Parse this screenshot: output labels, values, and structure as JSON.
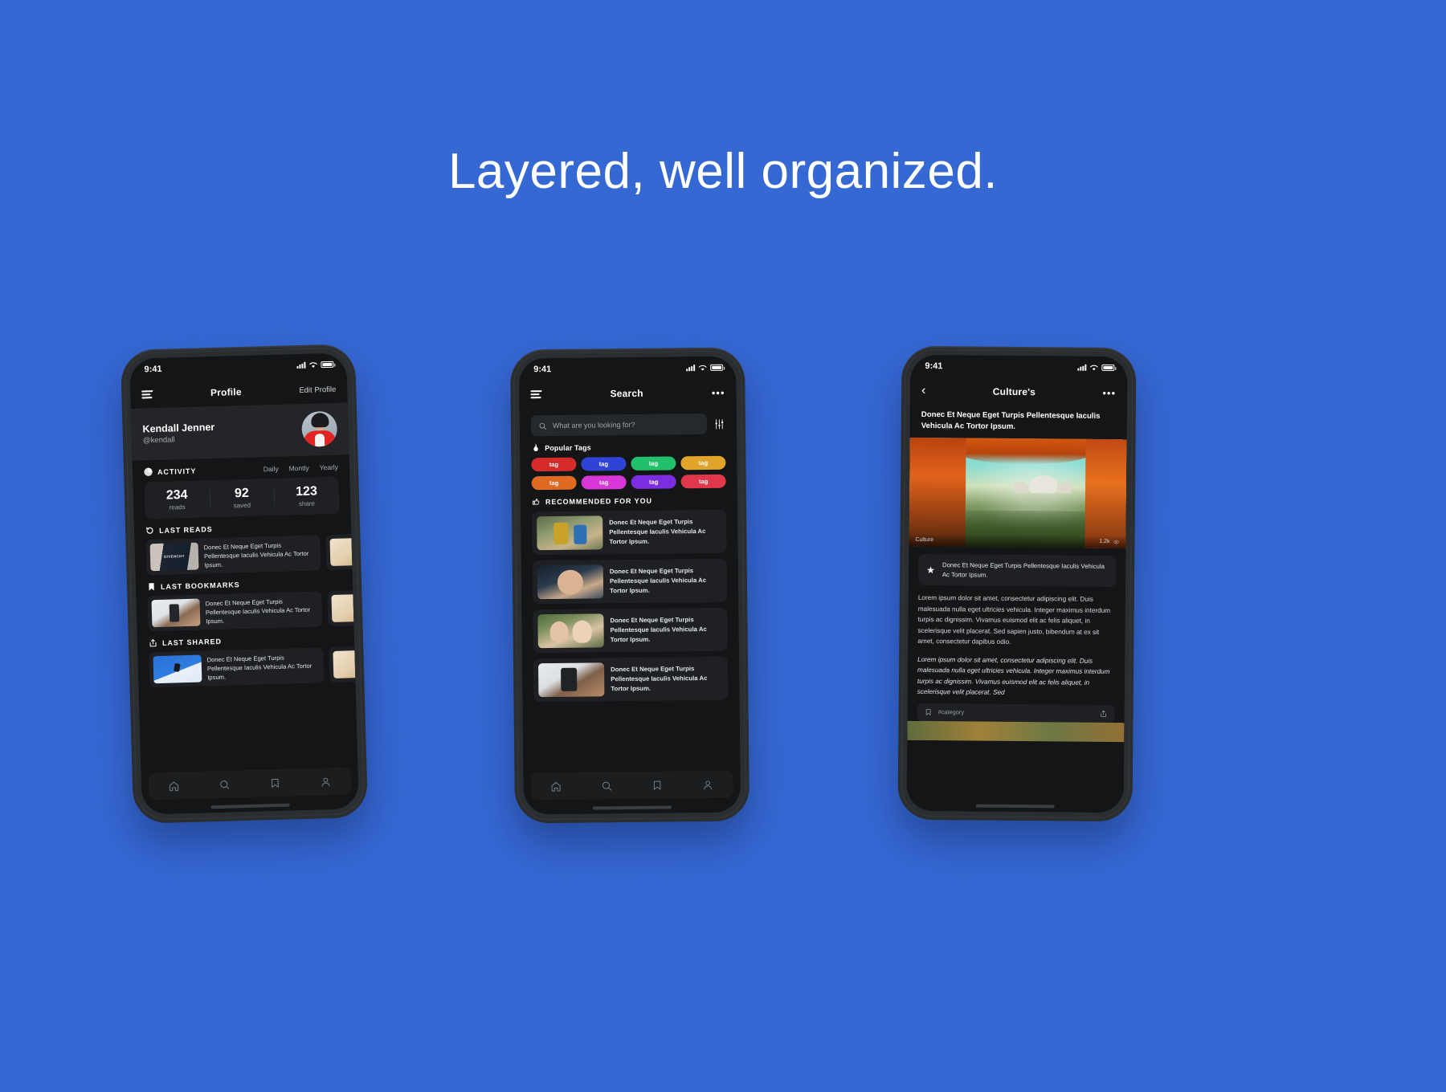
{
  "headline": "Layered, well organized.",
  "theme": {
    "background": "#3668d4",
    "surface": "#141516",
    "card": "#1e2023",
    "accent": "#2f6fdc"
  },
  "phone1": {
    "status": {
      "time": "9:41"
    },
    "navbar": {
      "menu_icon": "hamburger-icon",
      "title": "Profile",
      "action": "Edit Profile"
    },
    "profile": {
      "name": "Kendall Jenner",
      "handle": "@kendall",
      "avatar": "user-avatar"
    },
    "activity": {
      "icon": "pie-chart-icon",
      "label": "ACTIVITY",
      "segments": [
        "Daily",
        "Montly",
        "Yearly"
      ],
      "stats": [
        {
          "value": "234",
          "label": "reads"
        },
        {
          "value": "92",
          "label": "saved"
        },
        {
          "value": "123",
          "label": "share"
        }
      ]
    },
    "sections": [
      {
        "icon": "history-icon",
        "label": "LAST READS",
        "item": "Donec Et Neque Eget Turpis Pellentesque Iaculis Vehicula Ac Tortor Ipsum."
      },
      {
        "icon": "bookmark-icon",
        "label": "LAST BOOKMARKS",
        "item": "Donec Et Neque Eget Turpis Pellentesque Iaculis Vehicula Ac Tortor Ipsum."
      },
      {
        "icon": "share-icon",
        "label": "LAST SHARED",
        "item": "Donec Et Neque Eget Turpis Pellentesque Iaculis Vehicula Ac Tortor Ipsum."
      }
    ],
    "tabs": [
      "home-icon",
      "search-icon",
      "bookmark-icon",
      "person-icon"
    ]
  },
  "phone2": {
    "status": {
      "time": "9:41"
    },
    "navbar": {
      "menu_icon": "hamburger-icon",
      "title": "Search",
      "action": "more-icon"
    },
    "search": {
      "placeholder": "What are you looking for?",
      "icon": "search-icon",
      "filter_icon": "filter-sliders-icon"
    },
    "popular": {
      "icon": "fire-icon",
      "label": "Popular Tags",
      "tags": [
        {
          "label": "tag",
          "color": "#d62b2b"
        },
        {
          "label": "tag",
          "color": "#2f44d6"
        },
        {
          "label": "tag",
          "color": "#22c06a"
        },
        {
          "label": "tag",
          "color": "#e0a42a"
        },
        {
          "label": "tag",
          "color": "#e06a22"
        },
        {
          "label": "tag",
          "color": "#d637d6"
        },
        {
          "label": "tag",
          "color": "#7b2ee0"
        },
        {
          "label": "tag",
          "color": "#e0384a"
        }
      ]
    },
    "recommended": {
      "icon": "thumbs-up-icon",
      "label": "RECOMMENDED FOR YOU",
      "items": [
        {
          "text": "Donec Et Neque Eget Turpis Pellentesque Iaculis Vehicula Ac Tortor Ipsum.",
          "thumb": "dancers-thumb"
        },
        {
          "text": "Donec Et Neque Eget Turpis Pellentesque Iaculis Vehicula Ac Tortor Ipsum.",
          "thumb": "girl-thumb"
        },
        {
          "text": "Donec Et Neque Eget Turpis Pellentesque Iaculis Vehicula Ac Tortor Ipsum.",
          "thumb": "two-women-thumb"
        },
        {
          "text": "Donec Et Neque Eget Turpis Pellentesque Iaculis Vehicula Ac Tortor Ipsum.",
          "thumb": "hand-phone-thumb"
        }
      ]
    },
    "tabs": [
      "home-icon",
      "search-icon",
      "bookmark-icon",
      "person-icon"
    ]
  },
  "phone3": {
    "status": {
      "time": "9:41"
    },
    "navbar": {
      "back_icon": "chevron-left-icon",
      "title": "Culture's",
      "action": "more-icon"
    },
    "article": {
      "title": "Donec Et Neque Eget Turpis Pellentesque Iaculis Vehicula Ac Tortor Ipsum.",
      "hero": {
        "category": "Culture",
        "views": "1.2k",
        "views_icon": "eye-icon"
      },
      "highlight": {
        "icon": "star-icon",
        "text": "Donec Et Neque Eget Turpis Pellentesque Iaculis Vehicula Ac Tortor Ipsum."
      },
      "paragraph": "Lorem ipsum dolor sit amet, consectetur adipiscing elit. Duis malesuada nulla eget ultricies vehicula. Integer maximus interdum turpis ac dignissim. Vivamus euismod elit ac felis aliquet, in  scelerisque  velit placerat. Sed sapien justo, bibendum at ex sit amet, consectetur dapibus odio.",
      "paragraph_italic": "Lorem ipsum dolor sit amet, consectetur adipiscing elit. Duis malesuada nulla eget ultricies vehicula. Integer maximus interdum turpis ac dignissim. Vivamus euismod elit ac felis aliquet, in  scelerisque  velit placerat. Sed",
      "footer": {
        "bookmark_icon": "bookmark-icon",
        "category": "#category",
        "share_icon": "share-icon"
      }
    }
  }
}
